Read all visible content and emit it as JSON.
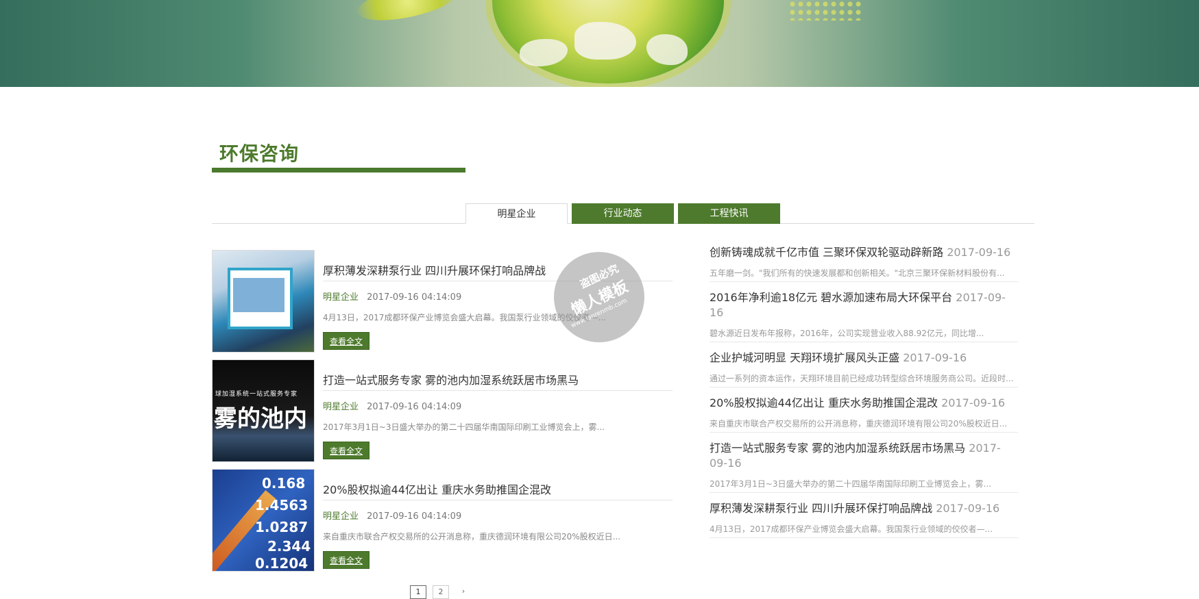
{
  "section": {
    "title": "环保咨询"
  },
  "tabs": [
    {
      "label": "明星企业"
    },
    {
      "label": "行业动态"
    },
    {
      "label": "工程快讯"
    }
  ],
  "news": [
    {
      "title": "厚积薄发深耕泵行业 四川升展环保打响品牌战",
      "category": "明星企业",
      "time": "2017-09-16 04:14:09",
      "desc": "4月13日，2017成都环保产业博览会盛大启幕。我国泵行业领域的佼佼者—...",
      "more": "查看全文"
    },
    {
      "title": "打造一站式服务专家 雾的池内加湿系统跃居市场黑马",
      "category": "明星企业",
      "time": "2017-09-16 04:14:09",
      "desc": "2017年3月1日~3日盛大举办的第二十四届华南国际印刷工业博览会上，雾...",
      "more": "查看全文",
      "thumb_text": "雾的池内",
      "thumb_small": "球加湿系统一站式服务专家"
    },
    {
      "title": "20%股权拟逾44亿出让 重庆水务助推国企混改",
      "category": "明星企业",
      "time": "2017-09-16 04:14:09",
      "desc": "来自重庆市联合产权交易所的公开消息称，重庆德润环境有限公司20%股权近日...",
      "more": "查看全文",
      "thumb_nums": [
        "0.168",
        "1.4563",
        "1.0287",
        "2.344",
        "0.1204"
      ]
    }
  ],
  "side": [
    {
      "title": "创新铸魂成就千亿市值 三聚环保双轮驱动辟新路",
      "date": "2017-09-16",
      "desc": "五年磨一剑。\"我们所有的快速发展都和创新相关。\"北京三聚环保新材料股份有..."
    },
    {
      "title": "2016年净利逾18亿元 碧水源加速布局大环保平台",
      "date": "2017-09-16",
      "desc": "碧水源近日发布年报称，2016年，公司实现营业收入88.92亿元，同比增..."
    },
    {
      "title": "企业护城河明显 天翔环境扩展风头正盛",
      "date": "2017-09-16",
      "desc": "通过一系列的资本运作，天翔环境目前已经成功转型综合环境服务商公司。近段时..."
    },
    {
      "title": "20%股权拟逾44亿出让 重庆水务助推国企混改",
      "date": "2017-09-16",
      "desc": "来自重庆市联合产权交易所的公开消息称，重庆德润环境有限公司20%股权近日..."
    },
    {
      "title": "打造一站式服务专家 雾的池内加湿系统跃居市场黑马",
      "date": "2017-09-16",
      "desc": "2017年3月1日~3日盛大举办的第二十四届华南国际印刷工业博览会上，雾..."
    },
    {
      "title": "厚积薄发深耕泵行业 四川升展环保打响品牌战",
      "date": "2017-09-16",
      "desc": "4月13日，2017成都环保产业博览会盛大启幕。我国泵行业领域的佼佼者—..."
    }
  ],
  "pager": {
    "current": "1",
    "page2": "2",
    "next": "›"
  },
  "watermark": {
    "top": "盗图必究",
    "mid": "懒人模板",
    "bot": "www.lanrenmb.com"
  },
  "colors": {
    "brand": "#4d7a2c",
    "banner": "#356e5c"
  }
}
